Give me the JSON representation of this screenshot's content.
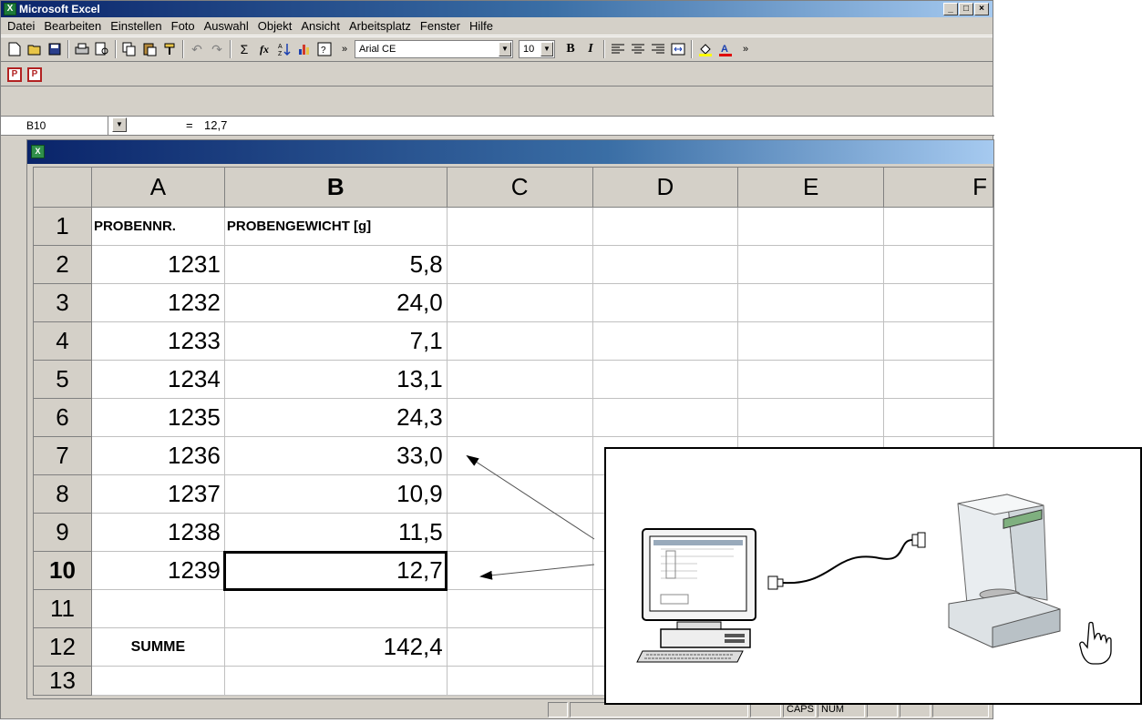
{
  "window": {
    "title": "Microsoft Excel"
  },
  "window_buttons": [
    "_",
    "□",
    "×"
  ],
  "menu": [
    "Datei",
    "Bearbeiten",
    "Einstellen",
    "Foto",
    "Auswahl",
    "Objekt",
    "Ansicht",
    "Arbeitsplatz",
    "Fenster",
    "Hilfe"
  ],
  "toolbar": {
    "font_name": "Arial CE",
    "font_size": "10",
    "bold_label": "B",
    "italic_label": "I",
    "sum_label": "Σ",
    "fx_label": "fx",
    "more_label": "»"
  },
  "formula_bar": {
    "cell_ref": "B10",
    "equals": "=",
    "value": "12,7"
  },
  "sheet": {
    "columns": [
      "A",
      "B",
      "C",
      "D",
      "E",
      "F"
    ],
    "rows": [
      {
        "n": "1",
        "a": "PROBENNR.",
        "b": "PROBENGEWICHT [g]"
      },
      {
        "n": "2",
        "a": "1231",
        "b": "5,8"
      },
      {
        "n": "3",
        "a": "1232",
        "b": "24,0"
      },
      {
        "n": "4",
        "a": "1233",
        "b": "7,1"
      },
      {
        "n": "5",
        "a": "1234",
        "b": "13,1"
      },
      {
        "n": "6",
        "a": "1235",
        "b": "24,3"
      },
      {
        "n": "7",
        "a": "1236",
        "b": "33,0"
      },
      {
        "n": "8",
        "a": "1237",
        "b": "10,9"
      },
      {
        "n": "9",
        "a": "1238",
        "b": "11,5"
      },
      {
        "n": "10",
        "a": "1239",
        "b": "12,7"
      },
      {
        "n": "11",
        "a": "",
        "b": ""
      },
      {
        "n": "12",
        "a": "SUMME",
        "b": "142,4"
      },
      {
        "n": "13",
        "a": "",
        "b": ""
      }
    ],
    "selected_cell": "B10"
  },
  "status_bar": {
    "caps": "CAPS",
    "num": "NUM"
  },
  "colors": {
    "title_dark": "#0a246a",
    "title_light": "#a6caf0",
    "chrome": "#d4d0c8"
  }
}
